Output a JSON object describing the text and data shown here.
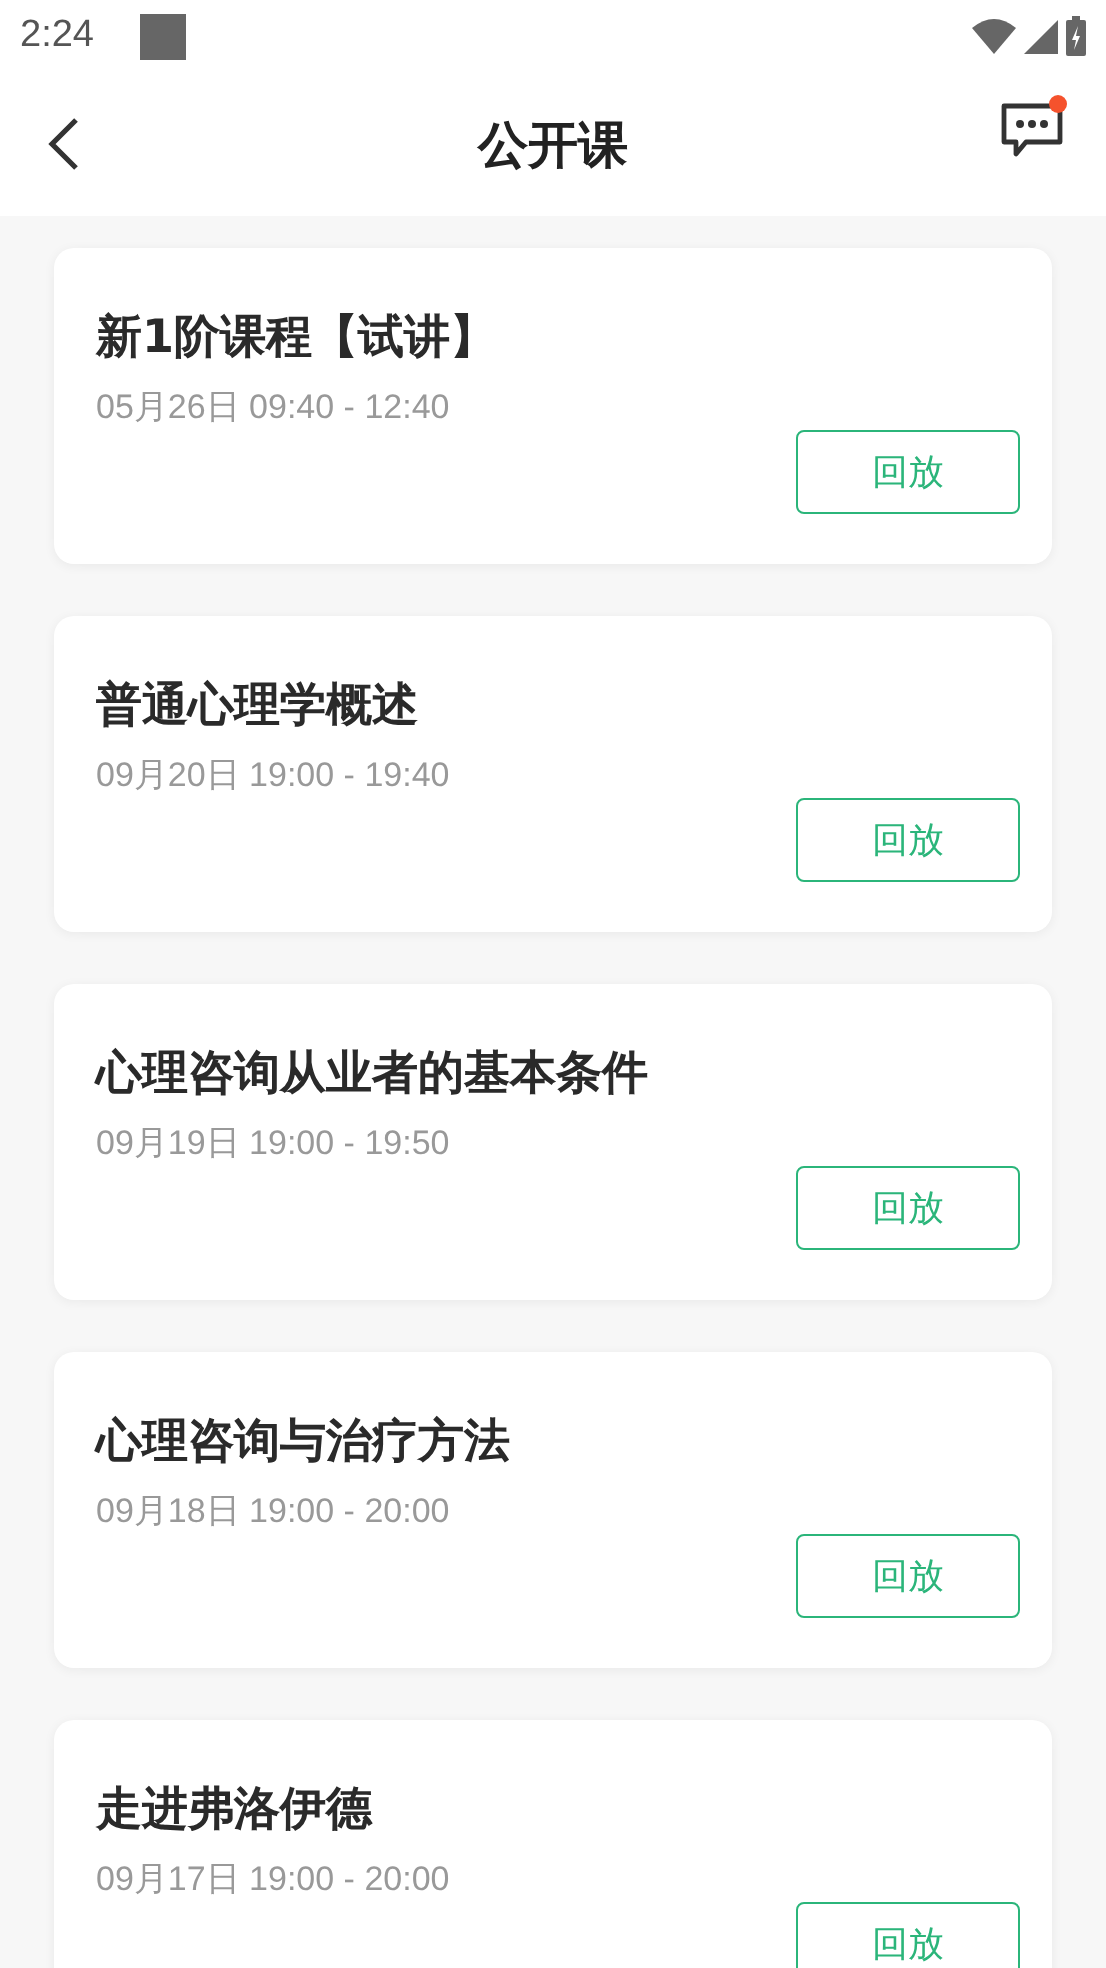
{
  "status_bar": {
    "time": "2:24"
  },
  "header": {
    "title": "公开课",
    "unread": true
  },
  "courses": [
    {
      "title": "新1阶课程【试讲】",
      "time": "05月26日 09:40 - 12:40",
      "action": "回放"
    },
    {
      "title": "普通心理学概述",
      "time": "09月20日 19:00 - 19:40",
      "action": "回放"
    },
    {
      "title": "心理咨询从业者的基本条件",
      "time": "09月19日 19:00 - 19:50",
      "action": "回放"
    },
    {
      "title": "心理咨询与治疗方法",
      "time": "09月18日 19:00 - 20:00",
      "action": "回放"
    },
    {
      "title": "走进弗洛伊德",
      "time": "09月17日 19:00 - 20:00",
      "action": "回放"
    }
  ]
}
